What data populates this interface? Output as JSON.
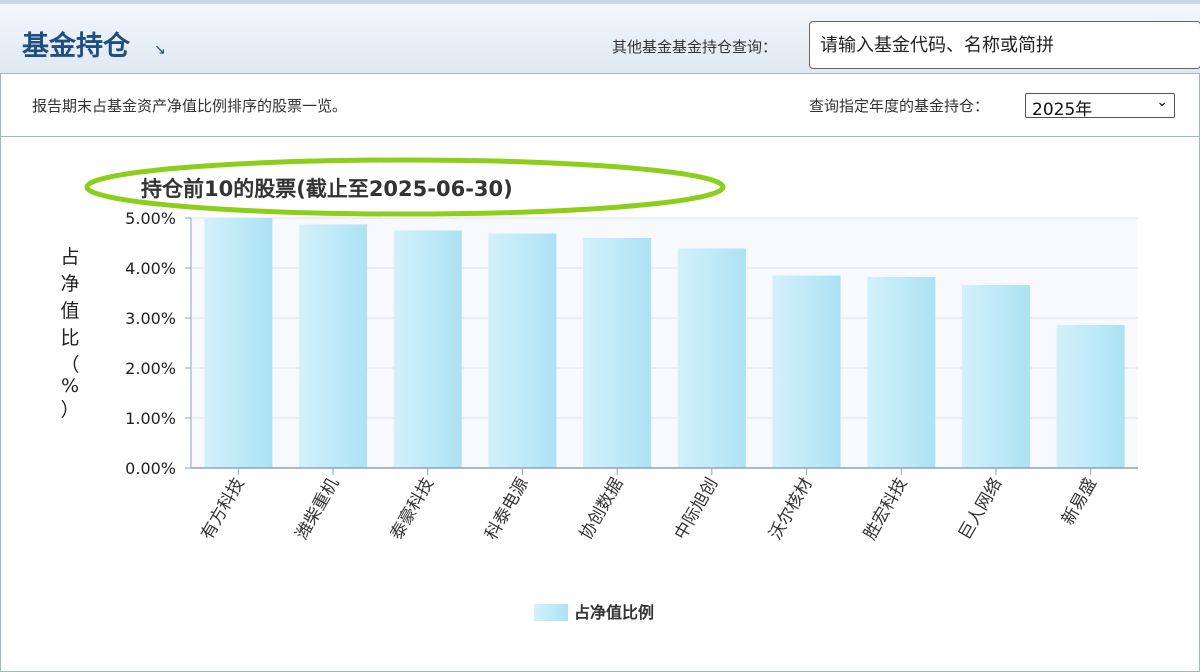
{
  "header": {
    "title": "基金持仓",
    "arrow": "↘",
    "search_label": "其他基金基金持仓查询：",
    "search_placeholder": "请输入基金代码、名称或简拼"
  },
  "subbar": {
    "description": "报告期末占基金资产净值比例排序的股票一览。",
    "year_label": "查询指定年度的基金持仓：",
    "year_selected": "2025年"
  },
  "colors": {
    "accent": "#1f4f82",
    "bar": "#bfe9f7",
    "highlight_ellipse": "#8ccf1a"
  },
  "chart_data": {
    "type": "bar",
    "title": "持仓前10的股票(截止至2025-06-30)",
    "ylabel": [
      "占",
      "净",
      "值",
      "比",
      "（",
      "%",
      "）"
    ],
    "xlabel": "",
    "categories": [
      "有方科技",
      "潍柴重机",
      "泰豪科技",
      "科泰电源",
      "协创数据",
      "中际旭创",
      "沃尔核材",
      "胜宏科技",
      "巨人网络",
      "新易盛"
    ],
    "values": [
      5.02,
      4.87,
      4.75,
      4.69,
      4.6,
      4.39,
      3.85,
      3.82,
      3.66,
      2.86
    ],
    "yticks": [
      "0.00%",
      "1.00%",
      "2.00%",
      "3.00%",
      "4.00%",
      "5.00%"
    ],
    "ylim": [
      0,
      5
    ],
    "legend": "占净值比例",
    "legend_position": "bottom-center",
    "grid": true
  }
}
